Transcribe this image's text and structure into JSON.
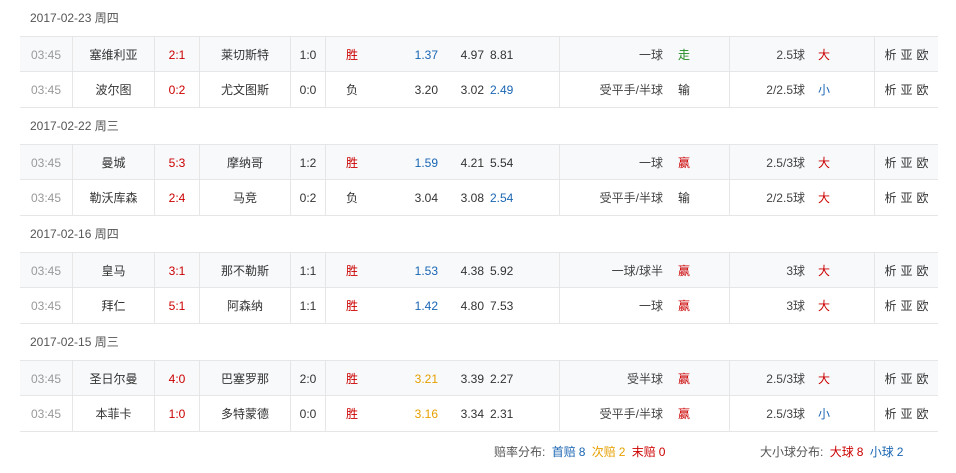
{
  "groups": [
    {
      "date": "2017-02-23 周四",
      "matches": [
        {
          "time": "03:45",
          "home": "塞维利亚",
          "score": "2:1",
          "away": "莱切斯特",
          "half": "1:0",
          "result": "胜",
          "result_color": "red",
          "odd1": "1.37",
          "odd1_color": "blue",
          "oddx": "4.97",
          "odd2": "8.81",
          "odd2_color": "dark",
          "handicap": "一球",
          "handicap_result": "走",
          "hres_color": "green",
          "ou_line": "2.5球",
          "ou_result": "大",
          "oures_color": "red"
        },
        {
          "time": "03:45",
          "home": "波尔图",
          "score": "0:2",
          "away": "尤文图斯",
          "half": "0:0",
          "result": "负",
          "result_color": "dark",
          "odd1": "3.20",
          "odd1_color": "dark",
          "oddx": "3.02",
          "odd2": "2.49",
          "odd2_color": "blue",
          "handicap": "受平手/半球",
          "handicap_result": "输",
          "hres_color": "dark",
          "ou_line": "2/2.5球",
          "ou_result": "小",
          "oures_color": "blue"
        }
      ]
    },
    {
      "date": "2017-02-22 周三",
      "matches": [
        {
          "time": "03:45",
          "home": "曼城",
          "score": "5:3",
          "away": "摩纳哥",
          "half": "1:2",
          "result": "胜",
          "result_color": "red",
          "odd1": "1.59",
          "odd1_color": "blue",
          "oddx": "4.21",
          "odd2": "5.54",
          "odd2_color": "dark",
          "handicap": "一球",
          "handicap_result": "赢",
          "hres_color": "red",
          "ou_line": "2.5/3球",
          "ou_result": "大",
          "oures_color": "red"
        },
        {
          "time": "03:45",
          "home": "勒沃库森",
          "score": "2:4",
          "away": "马竞",
          "half": "0:2",
          "result": "负",
          "result_color": "dark",
          "odd1": "3.04",
          "odd1_color": "dark",
          "oddx": "3.08",
          "odd2": "2.54",
          "odd2_color": "blue",
          "handicap": "受平手/半球",
          "handicap_result": "输",
          "hres_color": "dark",
          "ou_line": "2/2.5球",
          "ou_result": "大",
          "oures_color": "red"
        }
      ]
    },
    {
      "date": "2017-02-16 周四",
      "matches": [
        {
          "time": "03:45",
          "home": "皇马",
          "score": "3:1",
          "away": "那不勒斯",
          "half": "1:1",
          "result": "胜",
          "result_color": "red",
          "odd1": "1.53",
          "odd1_color": "blue",
          "oddx": "4.38",
          "odd2": "5.92",
          "odd2_color": "dark",
          "handicap": "一球/球半",
          "handicap_result": "赢",
          "hres_color": "red",
          "ou_line": "3球",
          "ou_result": "大",
          "oures_color": "red"
        },
        {
          "time": "03:45",
          "home": "拜仁",
          "score": "5:1",
          "away": "阿森纳",
          "half": "1:1",
          "result": "胜",
          "result_color": "red",
          "odd1": "1.42",
          "odd1_color": "blue",
          "oddx": "4.80",
          "odd2": "7.53",
          "odd2_color": "dark",
          "handicap": "一球",
          "handicap_result": "赢",
          "hres_color": "red",
          "ou_line": "3球",
          "ou_result": "大",
          "oures_color": "red"
        }
      ]
    },
    {
      "date": "2017-02-15 周三",
      "matches": [
        {
          "time": "03:45",
          "home": "圣日尔曼",
          "score": "4:0",
          "away": "巴塞罗那",
          "half": "2:0",
          "result": "胜",
          "result_color": "red",
          "odd1": "3.21",
          "odd1_color": "orange",
          "oddx": "3.39",
          "odd2": "2.27",
          "odd2_color": "dark",
          "handicap": "受半球",
          "handicap_result": "赢",
          "hres_color": "red",
          "ou_line": "2.5/3球",
          "ou_result": "大",
          "oures_color": "red"
        },
        {
          "time": "03:45",
          "home": "本菲卡",
          "score": "1:0",
          "away": "多特蒙德",
          "half": "0:0",
          "result": "胜",
          "result_color": "red",
          "odd1": "3.16",
          "odd1_color": "orange",
          "oddx": "3.34",
          "odd2": "2.31",
          "odd2_color": "dark",
          "handicap": "受平手/半球",
          "handicap_result": "赢",
          "hres_color": "red",
          "ou_line": "2.5/3球",
          "ou_result": "小",
          "oures_color": "blue"
        }
      ]
    }
  ],
  "links": [
    "析",
    "亚",
    "欧"
  ],
  "footer": {
    "odds_label": "赔率分布:",
    "first_label": "首赔",
    "first_count": "8",
    "second_label": "次赔",
    "second_count": "2",
    "last_label": "末赔",
    "last_count": "0",
    "ou_label": "大小球分布:",
    "big_label": "大球",
    "big_count": "8",
    "small_label": "小球",
    "small_count": "2"
  },
  "colors": {
    "red": "#cc0000",
    "blue": "#1a66b3",
    "green": "#228b22",
    "orange": "#e6a000",
    "dark": "#333333"
  }
}
